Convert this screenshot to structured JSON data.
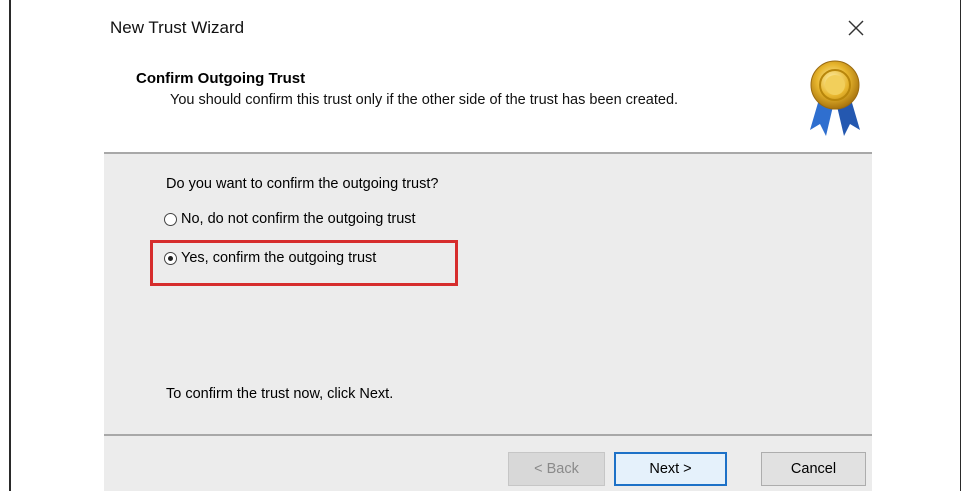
{
  "window": {
    "title": "New Trust Wizard",
    "close_icon": "close-icon"
  },
  "header": {
    "title": "Confirm Outgoing Trust",
    "subtitle": "You should confirm this trust only if the other side of the trust has been created.",
    "icon": "award-icon"
  },
  "body": {
    "question": "Do you want to confirm the outgoing trust?",
    "options": [
      {
        "label": "No, do not confirm the outgoing trust",
        "selected": false
      },
      {
        "label": "Yes, confirm the outgoing trust",
        "selected": true
      }
    ],
    "instruction": "To confirm the trust now, click Next."
  },
  "footer": {
    "back_label": "< Back",
    "next_label": "Next >",
    "cancel_label": "Cancel"
  },
  "colors": {
    "highlight": "#d62d2d",
    "default_button_border": "#1d71c7",
    "panel_bg": "#ececec"
  }
}
